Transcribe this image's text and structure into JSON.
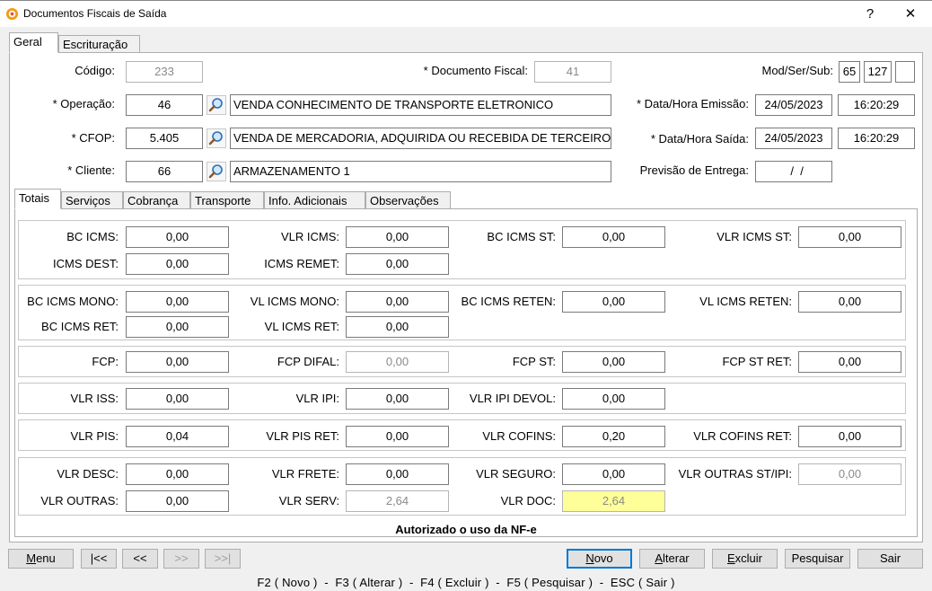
{
  "window": {
    "title": "Documentos Fiscais de Saída",
    "help": "?",
    "close": "✕"
  },
  "tabs": [
    "Geral",
    "Escrituração"
  ],
  "header": {
    "codigo_label": "Código:",
    "codigo_value": "233",
    "documento_fiscal_label": "* Documento Fiscal:",
    "documento_fiscal_value": "41",
    "mod_ser_sub_label": "Mod/Ser/Sub:",
    "mod": "65",
    "ser": "127",
    "sub": "",
    "operacao_label": "* Operação:",
    "operacao_code": "46",
    "operacao_desc": "VENDA CONHECIMENTO DE TRANSPORTE ELETRONICO",
    "data_emissao_label": "* Data/Hora Emissão:",
    "data_emissao": "24/05/2023",
    "hora_emissao": "16:20:29",
    "cfop_label": "* CFOP:",
    "cfop_code": "5.405",
    "cfop_desc": "VENDA DE MERCADORIA, ADQUIRIDA OU RECEBIDA DE TERCEIROS",
    "data_saida_label": "* Data/Hora Saída:",
    "data_saida": "24/05/2023",
    "hora_saida": "16:20:29",
    "cliente_label": "* Cliente:",
    "cliente_code": "66",
    "cliente_desc": "ARMAZENAMENTO 1",
    "previsao_label": "Previsão de Entrega:",
    "previsao_value": "  /  /"
  },
  "subtabs": [
    "Totais",
    "Serviços",
    "Cobrança",
    "Transporte",
    "Info. Adicionais",
    "Observações"
  ],
  "totais": {
    "bc_icms_label": "BC ICMS:",
    "bc_icms": "0,00",
    "vlr_icms_label": "VLR ICMS:",
    "vlr_icms": "0,00",
    "bc_icms_st_label": "BC ICMS ST:",
    "bc_icms_st": "0,00",
    "vlr_icms_st_label": "VLR ICMS ST:",
    "vlr_icms_st": "0,00",
    "icms_dest_label": "ICMS DEST:",
    "icms_dest": "0,00",
    "icms_remet_label": "ICMS REMET:",
    "icms_remet": "0,00",
    "bc_icms_mono_label": "BC ICMS MONO:",
    "bc_icms_mono": "0,00",
    "vl_icms_mono_label": "VL ICMS MONO:",
    "vl_icms_mono": "0,00",
    "bc_icms_reten_label": "BC ICMS RETEN:",
    "bc_icms_reten": "0,00",
    "vl_icms_reten_label": "VL ICMS RETEN:",
    "vl_icms_reten": "0,00",
    "bc_icms_ret_label": "BC ICMS RET:",
    "bc_icms_ret": "0,00",
    "vl_icms_ret_label": "VL ICMS RET:",
    "vl_icms_ret": "0,00",
    "fcp_label": "FCP:",
    "fcp": "0,00",
    "fcp_difal_label": "FCP DIFAL:",
    "fcp_difal": "0,00",
    "fcp_st_label": "FCP ST:",
    "fcp_st": "0,00",
    "fcp_st_ret_label": "FCP ST RET:",
    "fcp_st_ret": "0,00",
    "vlr_iss_label": "VLR ISS:",
    "vlr_iss": "0,00",
    "vlr_ipi_label": "VLR IPI:",
    "vlr_ipi": "0,00",
    "vlr_ipi_devol_label": "VLR IPI DEVOL:",
    "vlr_ipi_devol": "0,00",
    "vlr_pis_label": "VLR PIS:",
    "vlr_pis": "0,04",
    "vlr_pis_ret_label": "VLR PIS RET:",
    "vlr_pis_ret": "0,00",
    "vlr_cofins_label": "VLR COFINS:",
    "vlr_cofins": "0,20",
    "vlr_cofins_ret_label": "VLR COFINS RET:",
    "vlr_cofins_ret": "0,00",
    "vlr_desc_label": "VLR DESC:",
    "vlr_desc": "0,00",
    "vlr_frete_label": "VLR FRETE:",
    "vlr_frete": "0,00",
    "vlr_seguro_label": "VLR SEGURO:",
    "vlr_seguro": "0,00",
    "vlr_outras_st_ipi_label": "VLR OUTRAS ST/IPI:",
    "vlr_outras_st_ipi": "0,00",
    "vlr_outras_label": "VLR OUTRAS:",
    "vlr_outras": "0,00",
    "vlr_serv_label": "VLR SERV:",
    "vlr_serv": "2,64",
    "vlr_doc_label": "VLR DOC:",
    "vlr_doc": "2,64"
  },
  "status": "Autorizado o uso da NF-e",
  "buttons": {
    "menu_u": "M",
    "menu_rest": "enu",
    "first": "|<<",
    "prev": "<<",
    "next": ">>",
    "last": ">>|",
    "novo_u": "N",
    "novo_rest": "ovo",
    "alterar_u": "A",
    "alterar_rest": "lterar",
    "excluir_u": "E",
    "excluir_rest": "xcluir",
    "pesquisar": "Pesquisar",
    "sair": "Sair"
  },
  "shortcuts": "F2 ( Novo )  -  F3 ( Alterar )  -  F4 ( Excluir )  -  F5 ( Pesquisar )  -  ESC ( Sair )",
  "colors": {
    "highlight_field": "#ffff99",
    "default_button_border": "#0078d7"
  }
}
